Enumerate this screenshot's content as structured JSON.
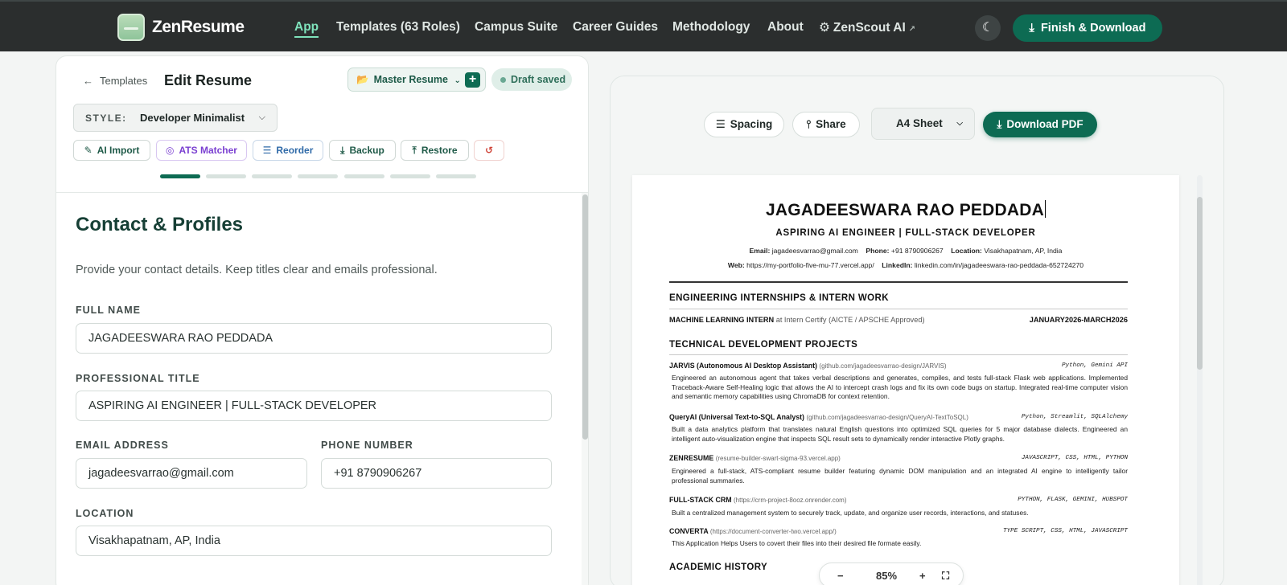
{
  "nav": {
    "brand": "ZenResume",
    "links": [
      "App",
      "Templates (63 Roles)",
      "Campus Suite",
      "Career Guides",
      "Methodology",
      "About",
      "ZenScout AI"
    ],
    "finish_label": "Finish & Download",
    "accent": "#0d6b53"
  },
  "editor": {
    "back_label": "Templates",
    "title": "Edit Resume",
    "master_label": "Master Resume",
    "draft_label": "Draft saved",
    "style_label": "STYLE:",
    "style_value": "Developer Minimalist",
    "tools": [
      "AI Import",
      "ATS Matcher",
      "Reorder",
      "Backup",
      "Restore"
    ],
    "progress_steps": 7,
    "progress_current": 1,
    "section_title": "Contact & Profiles",
    "section_desc": "Provide your contact details. Keep titles clear and emails professional.",
    "fields": {
      "full_name_label": "FULL NAME",
      "full_name": "JAGADEESWARA RAO PEDDADA",
      "title_label": "PROFESSIONAL TITLE",
      "title": "ASPIRING AI ENGINEER | FULL-STACK DEVELOPER",
      "email_label": "EMAIL ADDRESS",
      "email": "jagadeesvarrao@gmail.com",
      "phone_label": "PHONE NUMBER",
      "phone": "+91 8790906267",
      "location_label": "LOCATION",
      "location": "Visakhapatnam, AP, India"
    }
  },
  "preview": {
    "spacing_label": "Spacing",
    "share_label": "Share",
    "sheet_label": "A4 Sheet",
    "download_label": "Download PDF",
    "zoom": "85%"
  },
  "resume": {
    "name": "JAGADEESWARA RAO PEDDADA",
    "title": "ASPIRING AI ENGINEER | FULL-STACK DEVELOPER",
    "email_key": "Email:",
    "email": "jagadeesvarrao@gmail.com",
    "phone_key": "Phone:",
    "phone": "+91 8790906267",
    "location_key": "Location:",
    "location": "Visakhapatnam, AP, India",
    "web_key": "Web:",
    "web": "https://my-portfolio-five-mu-77.vercel.app/",
    "linkedin_key": "LinkedIn:",
    "linkedin": "linkedin.com/in/jagadeeswara-rao-peddada-652724270",
    "h_intern": "ENGINEERING INTERNSHIPS & INTERN WORK",
    "intern_role": "MACHINE LEARNING INTERN",
    "intern_org": "at Intern Certify (AICTE / APSCHE Approved)",
    "intern_dates": "JANUARY2026-MARCH2026",
    "h_projects": "TECHNICAL DEVELOPMENT PROJECTS",
    "projects": [
      {
        "name": "JARVIS (Autonomous AI Desktop Assistant)",
        "link": "(github.com/jagadeesvarrao-design/JARVIS)",
        "tech": "Python, Gemini API",
        "desc": "Engineered an autonomous agent that takes verbal descriptions and generates, compiles, and tests full-stack Flask web applications. Implemented Traceback-Aware Self-Healing logic that allows the AI to intercept crash logs and fix its own code bugs on startup. Integrated real-time computer vision and semantic memory capabilities using ChromaDB for context retention."
      },
      {
        "name": "QueryAI (Universal Text-to-SQL Analyst)",
        "link": "(github.com/jagadeesvarrao-design/QueryAI-TextToSQL)",
        "tech": "Python, Streamlit, SQLAlchemy",
        "desc": "Built a data analytics platform that translates natural English questions into optimized SQL queries for 5 major database dialects. Engineered an intelligent auto-visualization engine that inspects SQL result sets to dynamically render interactive Plotly graphs."
      },
      {
        "name": "ZENRESUME",
        "link": "(resume-builder-swart-sigma-93.vercel.app)",
        "tech": "JAVASCRIPT, CSS, HTML, PYTHON",
        "desc": "Engineered a full-stack, ATS-compliant resume builder featuring dynamic DOM manipulation and an integrated AI engine to intelligently tailor professional summaries."
      },
      {
        "name": "FULL-STACK CRM",
        "link": "(https://crm-project-8ooz.onrender.com)",
        "tech": "PYTHON, FLASK, GEMINI, HUBSPOT",
        "desc": "Built a centralized management system to securely track, update, and organize user records, interactions, and statuses."
      },
      {
        "name": "CONVERTA",
        "link": "(https://document-converter-two.vercel.app/)",
        "tech": "TYPE SCRIPT, CSS, HTML, JAVASCRIPT",
        "desc": "This Application Helps Users to covert their files into their desired file formate easily."
      }
    ],
    "h_academic": "ACADEMIC HISTORY"
  }
}
